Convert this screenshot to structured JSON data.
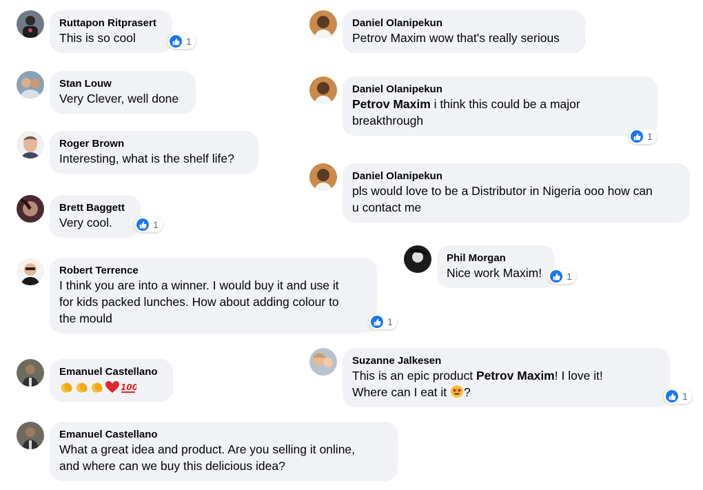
{
  "comments": [
    {
      "id": "ruttapon",
      "name": "Ruttapon Ritprasert",
      "text": "This is so cool",
      "likes": "1"
    },
    {
      "id": "stan",
      "name": "Stan Louw",
      "text": "Very Clever, well done"
    },
    {
      "id": "roger",
      "name": "Roger Brown",
      "text": "Interesting, what is the shelf life?"
    },
    {
      "id": "brett",
      "name": "Brett Baggett",
      "text": "Very cool.",
      "likes": "1"
    },
    {
      "id": "robert",
      "name": "Robert Terrence",
      "line1": "I think you are into a winner. I would buy it and use it",
      "line2": "for kids packed lunches. How about adding colour to",
      "line3": "the mould",
      "likes": "1"
    },
    {
      "id": "emanuel1",
      "name": "Emanuel Castellano",
      "emoji": [
        "clapping-hands",
        "clapping-hands",
        "clapping-hands",
        "red-heart",
        "hundred-points"
      ]
    },
    {
      "id": "emanuel2",
      "name": "Emanuel Castellano",
      "line1": "What a great idea and product. Are you selling it online,",
      "line2": "and where can we buy this delicious idea?"
    },
    {
      "id": "daniel1",
      "name": "Daniel Olanipekun",
      "text": "Petrov Maxim wow that's really serious"
    },
    {
      "id": "daniel2",
      "name": "Daniel Olanipekun",
      "mention": "Petrov Maxim",
      "line1_rest": " i think this could be a major",
      "line2": "breakthrough",
      "likes": "1"
    },
    {
      "id": "daniel3",
      "name": "Daniel Olanipekun",
      "line1": "pls would love to be a Distributor in Nigeria ooo how can",
      "line2": "u contact me"
    },
    {
      "id": "phil",
      "name": "Phil Morgan",
      "text": "Nice work Maxim!",
      "likes": "1"
    },
    {
      "id": "suzanne",
      "name": "Suzanne Jalkesen",
      "line1_pre": "This is an epic product ",
      "mention": "Petrov Maxim",
      "line1_post": "! I love it!",
      "line2_pre": "Where can I eat it ",
      "emoji": "star-struck",
      "line2_post": "?",
      "likes": "1"
    }
  ],
  "colors": {
    "bubble": "#f0f2f5",
    "like": "#1877f2",
    "text": "#050505",
    "count": "#65676b"
  }
}
